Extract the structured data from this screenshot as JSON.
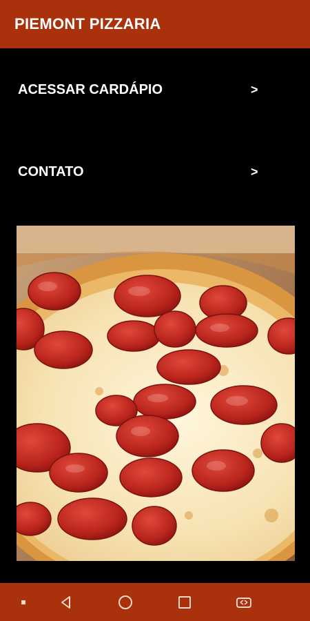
{
  "app": {
    "title": "PIEMONT PIZZARIA"
  },
  "menu": {
    "items": [
      {
        "label": "ACESSAR CARDÁPIO",
        "arrow": ">"
      },
      {
        "label": "CONTATO",
        "arrow": ">"
      }
    ]
  },
  "image": {
    "subject": "pepperoni-pizza"
  },
  "colors": {
    "brand": "#a9310b",
    "background": "#000000",
    "text": "#ffffff"
  },
  "system_nav": {
    "buttons": [
      "menu-dot",
      "back",
      "home",
      "recents",
      "switch-app"
    ]
  }
}
